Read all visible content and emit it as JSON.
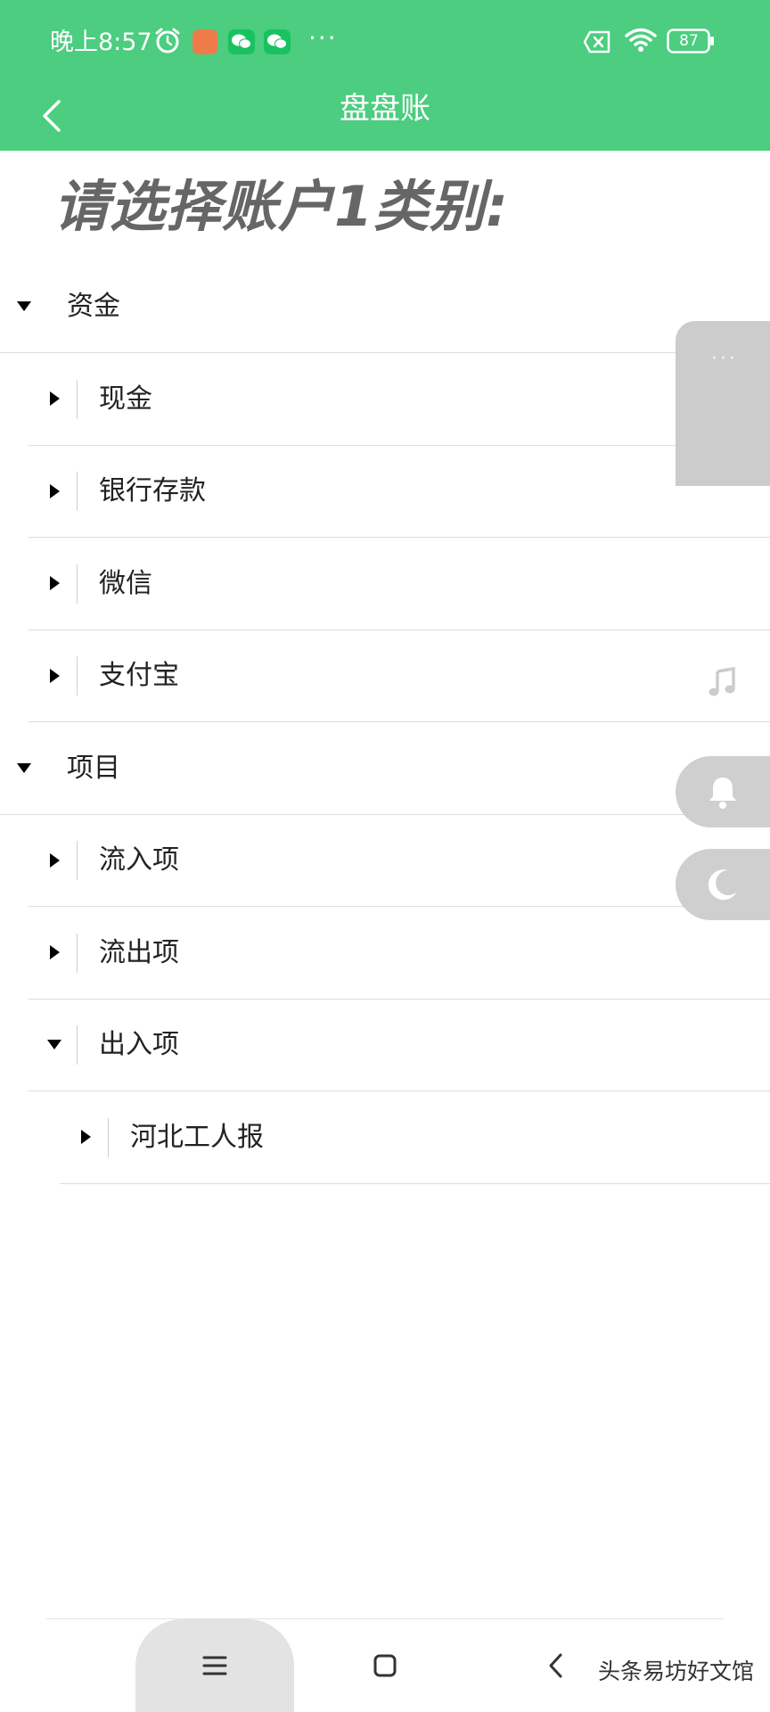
{
  "status_bar": {
    "time": "晚上8:57",
    "more": "···",
    "battery": "87"
  },
  "app_bar": {
    "title": "盘盘账"
  },
  "prompt": "请选择账户1类别:",
  "tree": [
    {
      "label": "资金",
      "level": 0,
      "expanded": true
    },
    {
      "label": "现金",
      "level": 1,
      "expanded": false
    },
    {
      "label": "银行存款",
      "level": 1,
      "expanded": false
    },
    {
      "label": "微信",
      "level": 1,
      "expanded": false
    },
    {
      "label": "支付宝",
      "level": 1,
      "expanded": false
    },
    {
      "label": "项目",
      "level": 0,
      "expanded": true
    },
    {
      "label": "流入项",
      "level": 1,
      "expanded": false
    },
    {
      "label": "流出项",
      "level": 1,
      "expanded": false
    },
    {
      "label": "出入项",
      "level": 1,
      "expanded": true
    },
    {
      "label": "河北工人报",
      "level": 2,
      "expanded": false
    }
  ],
  "side_panel": {
    "dots": "···"
  },
  "watermark": "头条易坊好文馆",
  "colors": {
    "header": "#4ccd80",
    "heading": "#666666",
    "side_panel": "#cccccc"
  }
}
